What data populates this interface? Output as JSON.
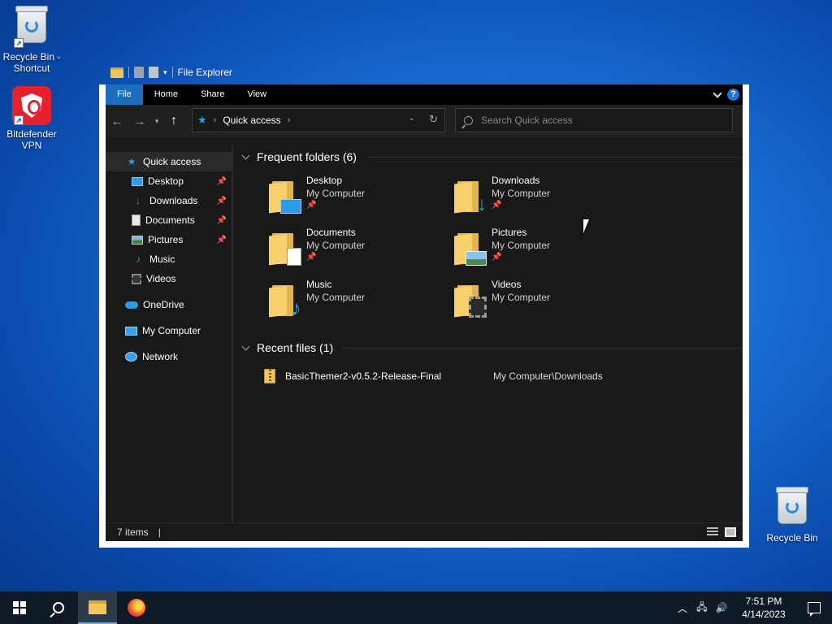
{
  "desktop": {
    "icons": [
      {
        "label": "Recycle Bin - Shortcut"
      },
      {
        "label": "Bitdefender VPN"
      },
      {
        "label": "Recycle Bin"
      }
    ]
  },
  "window": {
    "title": "File Explorer",
    "ribbon_tabs": [
      "File",
      "Home",
      "Share",
      "View"
    ],
    "help_label": "?",
    "address": {
      "location": "Quick access"
    },
    "search": {
      "placeholder": "Search Quick access"
    }
  },
  "sidebar": {
    "items": [
      {
        "label": "Quick access",
        "icon": "star-icon",
        "pinned": false
      },
      {
        "label": "Desktop",
        "icon": "desktop-icon",
        "pinned": true
      },
      {
        "label": "Downloads",
        "icon": "download-icon",
        "pinned": true
      },
      {
        "label": "Documents",
        "icon": "document-icon",
        "pinned": true
      },
      {
        "label": "Pictures",
        "icon": "picture-icon",
        "pinned": true
      },
      {
        "label": "Music",
        "icon": "music-icon",
        "pinned": false
      },
      {
        "label": "Videos",
        "icon": "video-icon",
        "pinned": false
      },
      {
        "label": "OneDrive",
        "icon": "cloud-icon",
        "pinned": false
      },
      {
        "label": "My Computer",
        "icon": "computer-icon",
        "pinned": false
      },
      {
        "label": "Network",
        "icon": "network-icon",
        "pinned": false
      }
    ]
  },
  "content": {
    "frequent_header": "Frequent folders (6)",
    "folders": [
      {
        "name": "Desktop",
        "location": "My Computer",
        "pinned": true
      },
      {
        "name": "Downloads",
        "location": "My Computer",
        "pinned": true
      },
      {
        "name": "Documents",
        "location": "My Computer",
        "pinned": true
      },
      {
        "name": "Pictures",
        "location": "My Computer",
        "pinned": true
      },
      {
        "name": "Music",
        "location": "My Computer",
        "pinned": false
      },
      {
        "name": "Videos",
        "location": "My Computer",
        "pinned": false
      }
    ],
    "recent_header": "Recent files (1)",
    "recent_files": [
      {
        "name": "BasicThemer2-v0.5.2-Release-Final",
        "path": "My Computer\\Downloads"
      }
    ]
  },
  "status": {
    "items_count": "7 items"
  },
  "taskbar": {
    "time": "7:51 PM",
    "date": "4/14/2023"
  },
  "colors": {
    "accent": "#1b6fba",
    "window_bg": "#191919",
    "desktop_bg": "#1a6fd6",
    "taskbar_bg": "#0f1a26"
  }
}
